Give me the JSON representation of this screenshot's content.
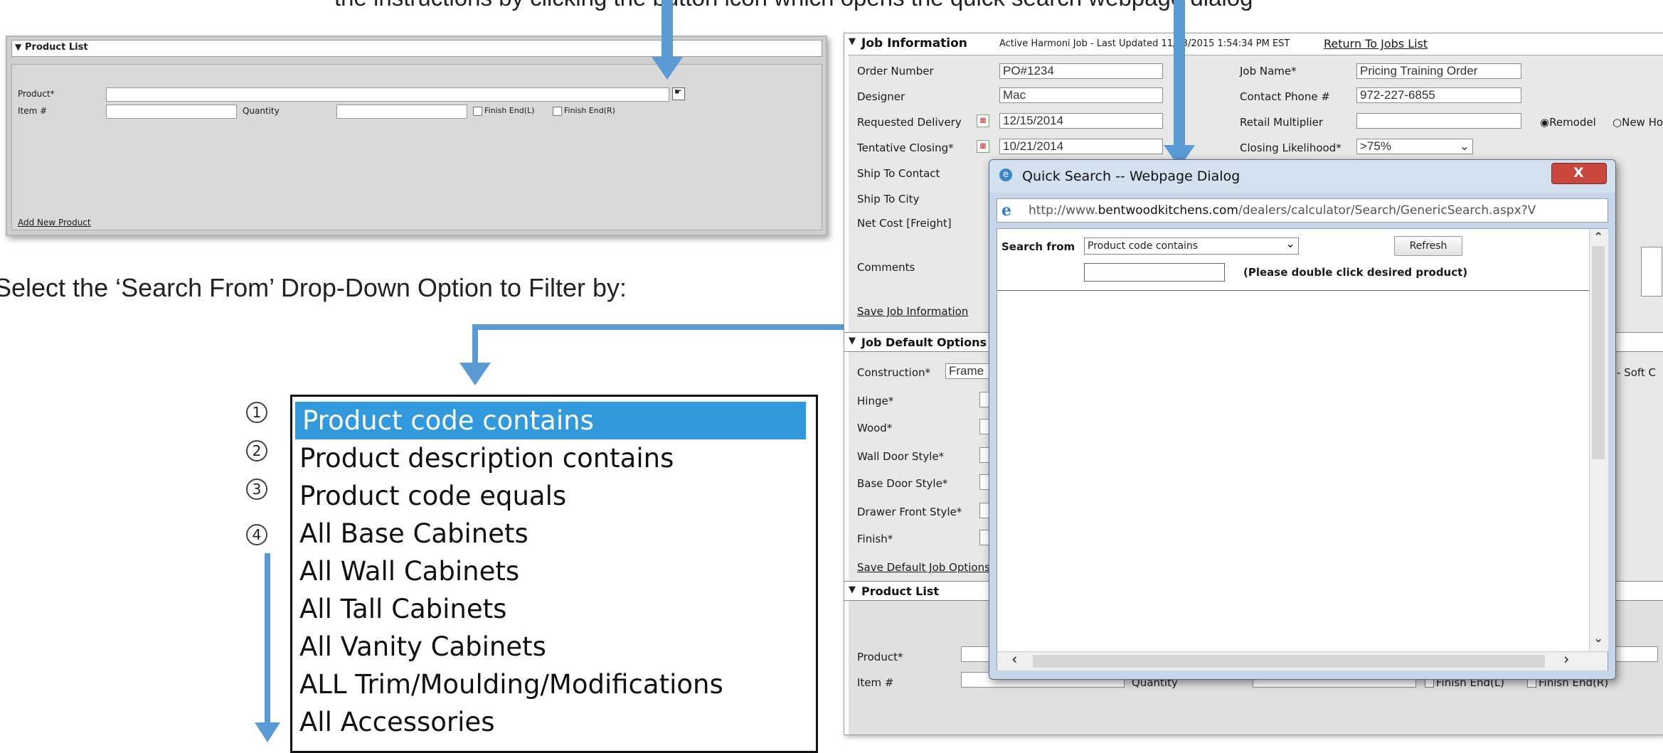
{
  "instruction_top": "the instructions by clicking the button icon which opens the quick search webpage dialog",
  "instruction_mid": "Select the ‘Search From’ Drop-Down Option to Filter by:",
  "small_panel": {
    "title": "Product List",
    "product_label": "Product*",
    "item_label": "Item #",
    "quantity_label": "Quantity",
    "finish_l": "Finish End(L)",
    "finish_r": "Finish End(R)",
    "add_link": "Add New Product"
  },
  "dropdown_list": {
    "items": [
      "Product code contains",
      "Product description contains",
      "Product code equals",
      "All Base Cabinets",
      "All Wall Cabinets",
      "All Tall Cabinets",
      "All Vanity Cabinets",
      "ALL Trim/Moulding/Modifications",
      "All Accessories"
    ],
    "numbers": [
      "1",
      "2",
      "3",
      "4"
    ]
  },
  "job": {
    "title": "Job Information",
    "status": "Active Harmoni Job - Last Updated 11/13/2015 1:54:34 PM EST",
    "return_link": "Return To Jobs List",
    "order_number_label": "Order Number",
    "order_number": "PO#1234",
    "designer_label": "Designer",
    "designer": "Mac",
    "requested_label": "Requested Delivery",
    "requested": "12/15/2014",
    "tentative_label": "Tentative Closing*",
    "tentative": "10/21/2014",
    "ship_contact_label": "Ship To Contact",
    "ship_city_label": "Ship To City",
    "net_cost_label": "Net Cost [Freight]",
    "comments_label": "Comments",
    "save_job": "Save Job Information",
    "job_name_label": "Job Name*",
    "job_name": "Pricing Training Order",
    "contact_phone_label": "Contact Phone #",
    "contact_phone": "972-227-6855",
    "retail_label": "Retail Multiplier",
    "closing_label": "Closing Likelihood*",
    "closing": ">75%",
    "remodel": "Remodel",
    "new_home": "New Ho"
  },
  "defaults": {
    "title": "Job Default Options",
    "construction_label": "Construction*",
    "construction": "Frame",
    "hinge_label": "Hinge*",
    "wood_label": "Wood*",
    "wall_door_label": "Wall Door Style*",
    "base_door_label": "Base Door Style*",
    "drawer_label": "Drawer Front Style*",
    "finish_label": "Finish*",
    "save_defaults": "Save Default Job Options",
    "soft_close": "- Soft C"
  },
  "bottom_list": {
    "title": "Product List",
    "product_label": "Product*",
    "item_label": "Item #",
    "quantity_label": "Quantity",
    "finish_l": "Finish End(L)",
    "finish_r": "Finish End(R)"
  },
  "dialog": {
    "title": "Quick Search -- Webpage Dialog",
    "url_prefix": "http://www.",
    "url_domain": "bentwoodkitchens.com",
    "url_rest": "/dealers/calculator/Search/GenericSearch.aspx?V",
    "search_from_label": "Search from",
    "search_from_value": "Product code contains",
    "refresh": "Refresh",
    "hint": "(Please double click desired product)",
    "close": "X"
  },
  "colors": {
    "arrow": "#5b9bd5",
    "highlight": "#3399dd",
    "panel_bg": "#d9d9d9",
    "dialog_close": "#c9463d"
  }
}
